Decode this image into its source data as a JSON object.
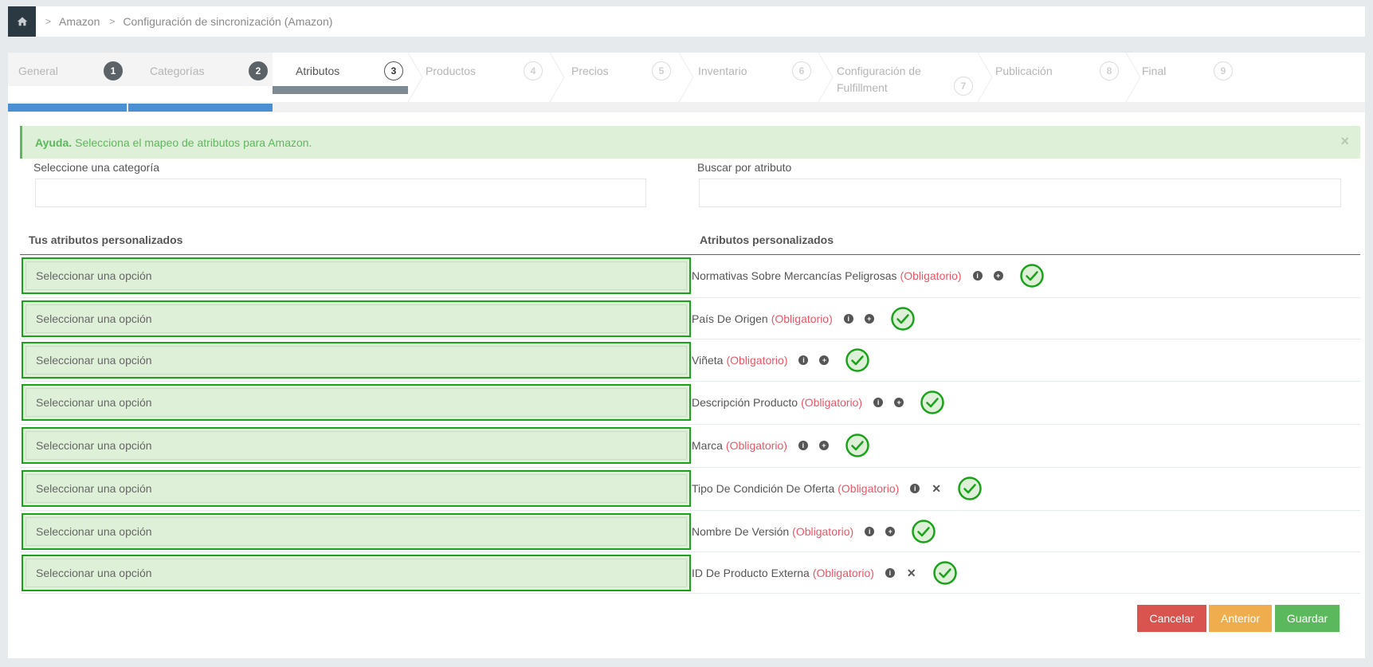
{
  "breadcrumb": {
    "items": [
      "Amazon",
      "Configuración de sincronización (Amazon)"
    ]
  },
  "wizard": {
    "steps": [
      {
        "label": "General",
        "num": "1",
        "state": "done"
      },
      {
        "label": "Categorías",
        "num": "2",
        "state": "done"
      },
      {
        "label": "Atributos",
        "num": "3",
        "state": "active"
      },
      {
        "label": "Productos",
        "num": "4",
        "state": "todo"
      },
      {
        "label": "Precios",
        "num": "5",
        "state": "todo"
      },
      {
        "label": "Inventario",
        "num": "6",
        "state": "todo"
      },
      {
        "label": "Configuración de Fulfillment",
        "num": "7",
        "state": "todo"
      },
      {
        "label": "Publicación",
        "num": "8",
        "state": "todo"
      },
      {
        "label": "Final",
        "num": "9",
        "state": "todo"
      }
    ]
  },
  "alert": {
    "title": "Ayuda.",
    "text": "Selecciona el mapeo de atributos para Amazon.",
    "close": "×"
  },
  "filters": {
    "category_label": "Seleccione una categoría",
    "search_label": "Buscar por atributo"
  },
  "columns": {
    "left": "Tus atributos personalizados",
    "right": "Atributos personalizados"
  },
  "rows": [
    {
      "select": "Seleccionar una opción",
      "attr": "Normativas Sobre Mercancías Peligrosas",
      "req": "(Obligatorio)",
      "action": "plus"
    },
    {
      "select": "Seleccionar una opción",
      "attr": "País De Origen",
      "req": "(Obligatorio)",
      "action": "plus"
    },
    {
      "select": "Seleccionar una opción",
      "attr": "Viñeta",
      "req": "(Obligatorio)",
      "action": "plus"
    },
    {
      "select": "Seleccionar una opción",
      "attr": "Descripción Producto",
      "req": "(Obligatorio)",
      "action": "plus"
    },
    {
      "select": "Seleccionar una opción",
      "attr": "Marca",
      "req": "(Obligatorio)",
      "action": "plus"
    },
    {
      "select": "Seleccionar una opción",
      "attr": "Tipo De Condición De Oferta",
      "req": "(Obligatorio)",
      "action": "remove"
    },
    {
      "select": "Seleccionar una opción",
      "attr": "Nombre De Versión",
      "req": "(Obligatorio)",
      "action": "plus"
    },
    {
      "select": "Seleccionar una opción",
      "attr": "ID De Producto Externa",
      "req": "(Obligatorio)",
      "action": "remove"
    }
  ],
  "buttons": {
    "cancel": "Cancelar",
    "previous": "Anterior",
    "save": "Guardar"
  },
  "colors": {
    "success": "#1aa31a",
    "required": "#ed5565",
    "progress": "#4a8fd4"
  },
  "icons": {
    "home": "home-icon",
    "info": "info-circle-icon",
    "add": "plus-circle-icon",
    "remove": "close-icon",
    "check": "check-circle-icon"
  }
}
